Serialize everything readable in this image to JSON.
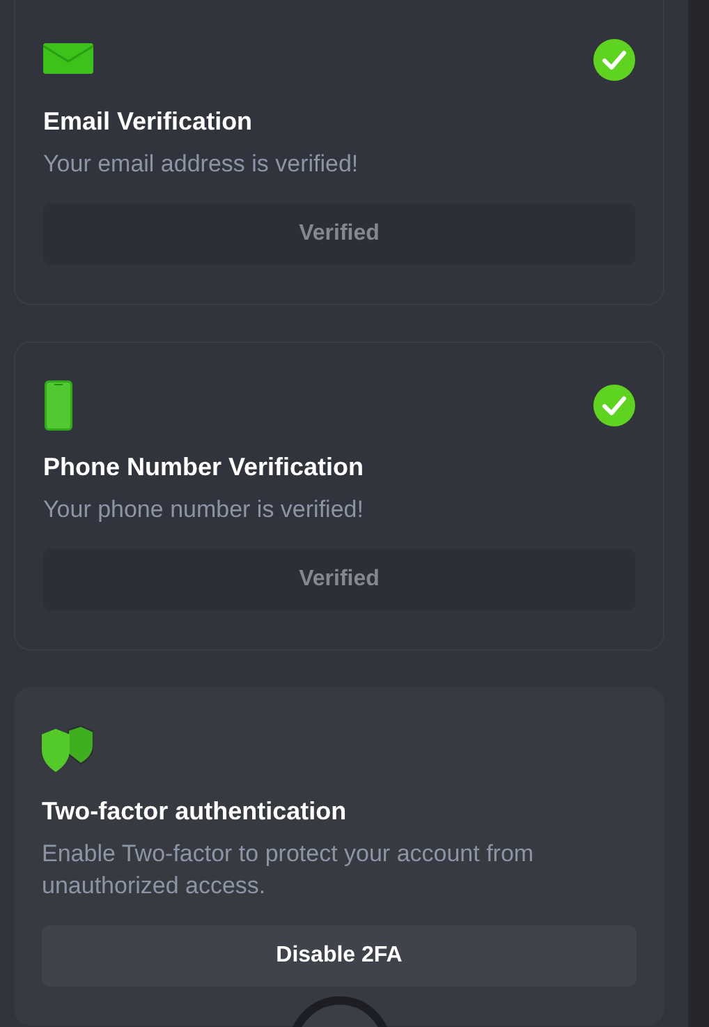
{
  "cards": [
    {
      "kind": "email",
      "title": "Email Verification",
      "description": "Your email address is verified!",
      "verified": true,
      "button": {
        "label": "Verified",
        "disabled": true
      }
    },
    {
      "kind": "phone",
      "title": "Phone Number Verification",
      "description": "Your phone number is verified!",
      "verified": true,
      "button": {
        "label": "Verified",
        "disabled": true
      }
    },
    {
      "kind": "two_factor",
      "title": "Two-factor authentication",
      "description": "Enable Two-factor to protect your account from unauthorized access.",
      "verified": false,
      "button": {
        "label": "Disable 2FA",
        "disabled": false
      }
    }
  ]
}
